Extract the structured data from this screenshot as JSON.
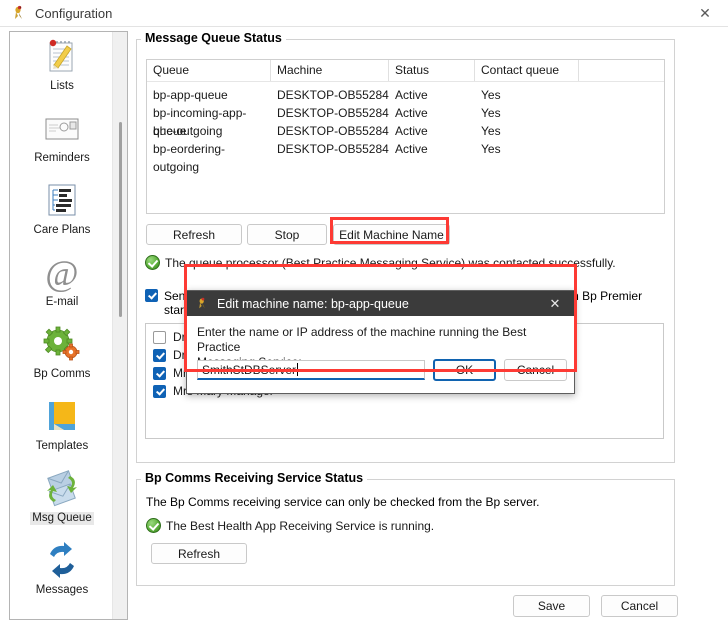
{
  "window": {
    "title": "Configuration",
    "close_label": "✕",
    "icon": "bp-bird-icon"
  },
  "sidebar": {
    "items": [
      {
        "label": "Lists",
        "icon": "notepad-pencil-icon",
        "selected": false
      },
      {
        "label": "Reminders",
        "icon": "envelope-icon",
        "selected": false
      },
      {
        "label": "Care Plans",
        "icon": "document-outline-icon",
        "selected": false
      },
      {
        "label": "E-mail",
        "icon": "at-sign-icon",
        "selected": false
      },
      {
        "label": "Bp Comms",
        "icon": "gears-icon",
        "selected": false
      },
      {
        "label": "Templates",
        "icon": "folder-page-icon",
        "selected": false
      },
      {
        "label": "Msg Queue",
        "icon": "envelopes-arrows-icon",
        "selected": true
      },
      {
        "label": "Messages",
        "icon": "blue-arrows-cycle-icon",
        "selected": false
      }
    ]
  },
  "message_queue_status": {
    "title": "Message Queue Status",
    "table": {
      "columns": [
        "Queue",
        "Machine",
        "Status",
        "Contact queue",
        ""
      ],
      "rows": [
        [
          "bp-app-queue",
          "DESKTOP-OB55284",
          "Active",
          "Yes",
          ""
        ],
        [
          "bp-incoming-app-queue",
          "DESKTOP-OB55284",
          "Active",
          "Yes",
          ""
        ],
        [
          "bhc-outgoing",
          "DESKTOP-OB55284",
          "Active",
          "Yes",
          ""
        ],
        [
          "bp-eordering-outgoing",
          "DESKTOP-OB55284",
          "Active",
          "Yes",
          ""
        ]
      ]
    },
    "buttons": {
      "refresh": "Refresh",
      "stop": "Stop",
      "edit_machine_name": "Edit Machine Name"
    },
    "status_line": "The queue processor (Best Practice Messaging Service) was contacted successfully.",
    "send_checkbox": {
      "checked": true,
      "text_before": "Send",
      "text_after": "hen Bp Premier",
      "second_line": "starts:"
    },
    "user_list": [
      {
        "label": "Dr C",
        "checked": false
      },
      {
        "label": "Dr Fr",
        "checked": true
      },
      {
        "label": "Mr S",
        "checked": true
      },
      {
        "label": "Mrs Mary Manager",
        "checked": true
      }
    ]
  },
  "receiving_service_status": {
    "title": "Bp Comms Receiving Service Status",
    "note": "The Bp Comms receiving service can only be checked from the Bp server.",
    "status_line": "The Best Health App Receiving Service is running.",
    "refresh_button": "Refresh"
  },
  "footer": {
    "save": "Save",
    "cancel": "Cancel"
  },
  "dialog": {
    "title": "Edit machine name: bp-app-queue",
    "icon": "bp-bird-icon",
    "close_label": "✕",
    "prompt_line1": "Enter the name or IP address of the machine running the Best Practice",
    "prompt_line2": "Messaging Service:",
    "input_value": "SmithStDBServer",
    "ok": "OK",
    "cancel": "Cancel"
  },
  "annotations": {
    "highlight_color": "#fd3a34"
  }
}
